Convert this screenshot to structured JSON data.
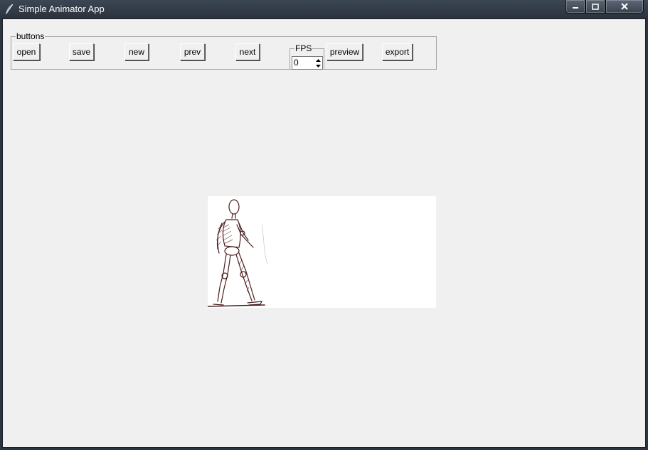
{
  "window": {
    "title": "Simple Animator App",
    "icon": "feather-icon",
    "controls": [
      "minimize-icon",
      "maximize-icon",
      "close-icon"
    ]
  },
  "toolbar": {
    "group_label": "buttons",
    "open_label": "open",
    "save_label": "save",
    "new_label": "new",
    "prev_label": "prev",
    "next_label": "next",
    "preview_label": "preview",
    "export_label": "export"
  },
  "fps": {
    "label": "FPS",
    "value": "0"
  },
  "canvas": {
    "content": "walking-figure-sketch"
  }
}
